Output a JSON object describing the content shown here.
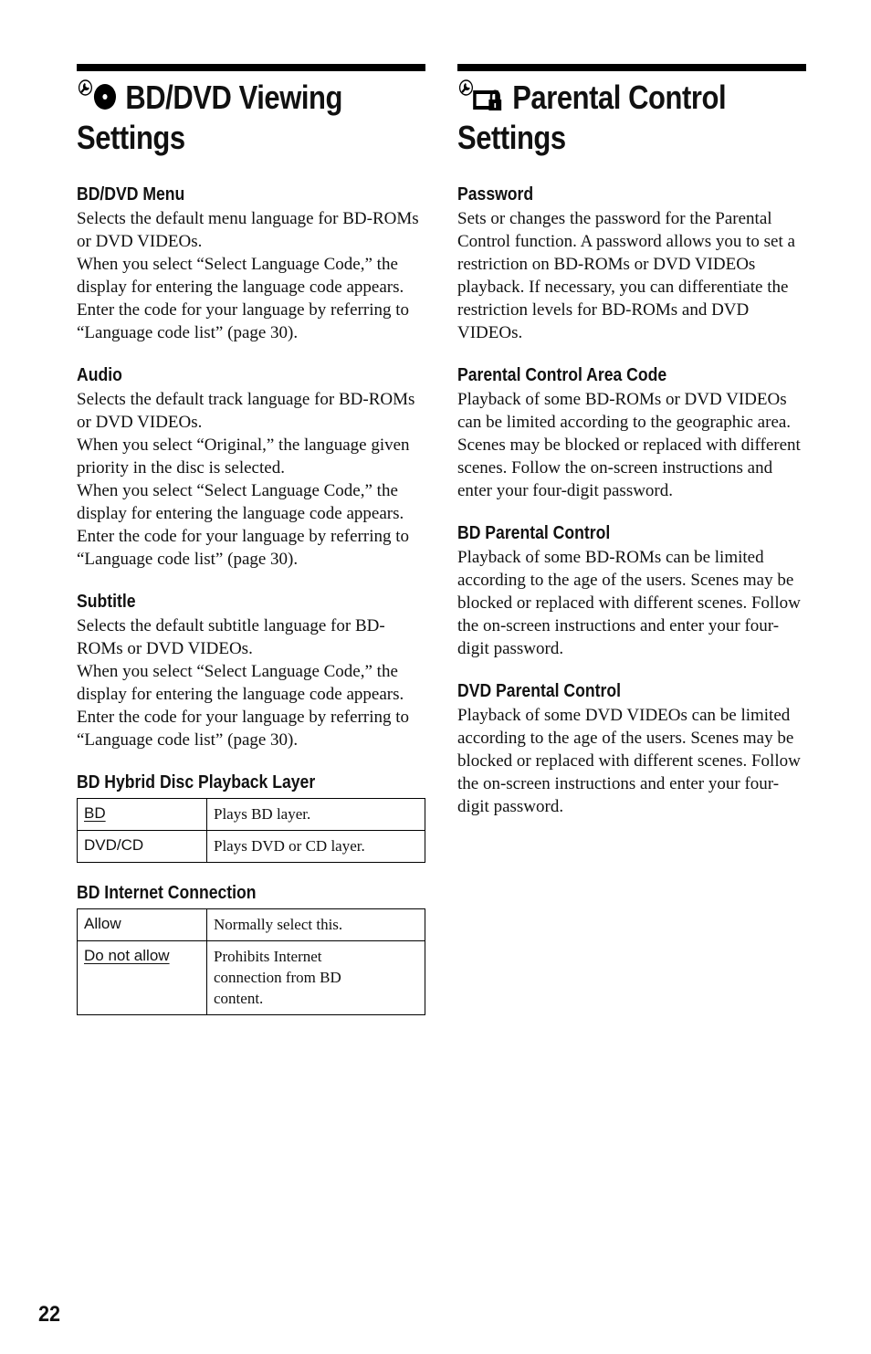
{
  "page_number": "22",
  "left_column": {
    "title_line1": "BD/DVD Viewing",
    "title_line2": "Settings",
    "title_icon": "wrench-disc-icon",
    "sections": [
      {
        "heading": "BD/DVD Menu",
        "body": "Selects the default menu language for BD-ROMs or DVD VIDEOs.\nWhen you select “Select Language Code,” the display for entering the language code appears. Enter the code for your language by referring to “Language code list” (page 30)."
      },
      {
        "heading": "Audio",
        "body": "Selects the default track language for BD-ROMs or DVD VIDEOs.\nWhen you select “Original,” the language given priority in the disc is selected.\nWhen you select “Select Language Code,” the display for entering the language code appears. Enter the code for your language by referring to “Language code list” (page 30)."
      },
      {
        "heading": "Subtitle",
        "body": "Selects the default subtitle language for BD-ROMs or DVD VIDEOs.\nWhen you select “Select Language Code,” the display for entering the language code appears. Enter the code for your language by referring to “Language code list” (page 30)."
      }
    ],
    "hybrid": {
      "heading": "BD Hybrid Disc Playback Layer",
      "rows": [
        {
          "option": "BD",
          "description": "Plays BD layer.",
          "default": true
        },
        {
          "option": "DVD/CD",
          "description": "Plays DVD or CD layer.",
          "default": false
        }
      ]
    },
    "internet": {
      "heading": "BD Internet Connection",
      "rows": [
        {
          "option": "Allow",
          "description": "Normally select this.",
          "default": false
        },
        {
          "option": "Do not allow",
          "description": "Prohibits Internet connection from BD content.",
          "default": true
        }
      ]
    }
  },
  "right_column": {
    "title_line1": "Parental Control",
    "title_line2": "Settings",
    "title_icon": "wrench-lock-icon",
    "sections": [
      {
        "heading": "Password",
        "body": "Sets or changes the password for the Parental Control function. A password allows you to set a restriction on BD-ROMs or DVD VIDEOs playback. If necessary, you can differentiate the restriction levels for BD-ROMs and DVD VIDEOs."
      },
      {
        "heading": "Parental Control Area Code",
        "body": "Playback of some BD-ROMs or DVD VIDEOs can be limited according to the geographic area. Scenes may be blocked or replaced with different scenes. Follow the on-screen instructions and enter your four-digit password."
      },
      {
        "heading": "BD Parental Control",
        "body": "Playback of some BD-ROMs can be limited according to the age of the users. Scenes may be blocked or replaced with different scenes. Follow the on-screen instructions and enter your four-digit password."
      },
      {
        "heading": "DVD Parental Control",
        "body": "Playback of some DVD VIDEOs can be limited according to the age of the users. Scenes may be blocked or replaced with different scenes. Follow the on-screen instructions and enter your four-digit password."
      }
    ]
  }
}
